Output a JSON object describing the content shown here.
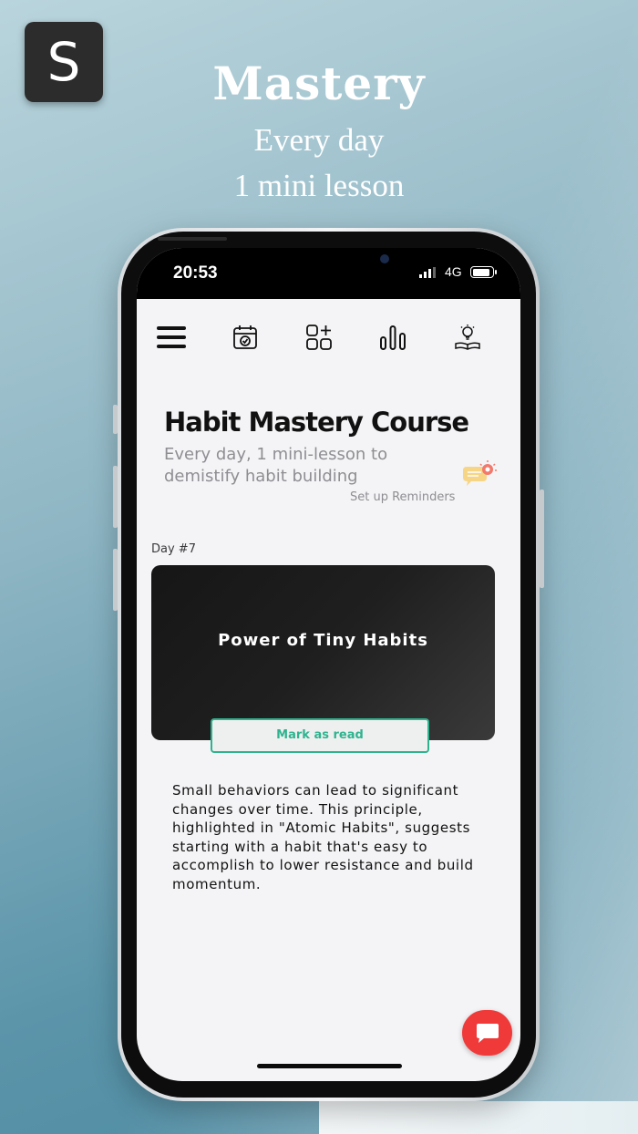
{
  "promo": {
    "logo_letter": "S",
    "headline": "Mastery",
    "subline1": "Every day",
    "subline2": "1 mini lesson"
  },
  "statusbar": {
    "time": "20:53",
    "network": "4G"
  },
  "navbar": {
    "icons": [
      "menu-icon",
      "calendar-check-icon",
      "add-habit-grid-icon",
      "stats-bars-icon",
      "lightbulb-book-icon"
    ]
  },
  "course": {
    "title": "Habit Mastery Course",
    "subtitle": "Every day, 1 mini-lesson to demistify habit building",
    "reminder_link": "Set up Reminders"
  },
  "lesson": {
    "day_label": "Day #7",
    "card_title": "Power of Tiny Habits",
    "mark_button": "Mark as read",
    "body": "Small behaviors can lead to significant changes over time. This principle, highlighted in \"Atomic Habits\", suggests starting with a habit that's easy to accomplish to lower resistance and build momentum."
  },
  "colors": {
    "accent": "#2fb38f",
    "fab": "#f03a3a",
    "card": "#1f1f1f"
  }
}
